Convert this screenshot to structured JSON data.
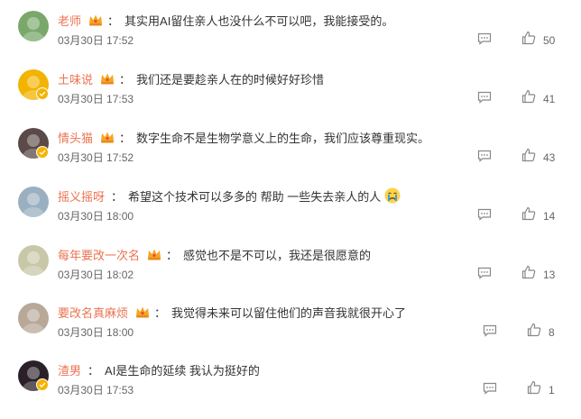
{
  "comments": [
    {
      "user": "老师",
      "text": "其实用AI留住亲人也没什么不可以吧，我能接受的。",
      "date": "03月30日 17:52",
      "likes": "50",
      "has_crown": true,
      "verified": false,
      "emoji": "",
      "avatar_color": "#7aa86b"
    },
    {
      "user": "土味说",
      "text": "我们还是要趁亲人在的时候好好珍惜",
      "date": "03月30日 17:53",
      "likes": "41",
      "has_crown": true,
      "verified": true,
      "emoji": "",
      "avatar_color": "#f2b400"
    },
    {
      "user": "情头猫",
      "text": "数字生命不是生物学意义上的生命，我们应该尊重现实。",
      "date": "03月30日 17:52",
      "likes": "43",
      "has_crown": true,
      "verified": true,
      "emoji": "",
      "avatar_color": "#5a4a48"
    },
    {
      "user": "摇义摇呀",
      "text": "希望这个技术可以多多的 帮助 一些失去亲人的人",
      "date": "03月30日 18:00",
      "likes": "14",
      "has_crown": false,
      "verified": false,
      "emoji": "crying-emoji",
      "avatar_color": "#9ab0c0"
    },
    {
      "user": "每年要改一次名",
      "text": "感觉也不是不可以，我还是很愿意的",
      "date": "03月30日 18:02",
      "likes": "13",
      "has_crown": true,
      "verified": false,
      "emoji": "",
      "avatar_color": "#c8c8a8"
    },
    {
      "user": "要改名真麻烦",
      "text": "我觉得未来可以留住他们的声音我就很开心了",
      "date": "03月30日 18:00",
      "likes": "8",
      "has_crown": true,
      "verified": false,
      "emoji": "",
      "avatar_color": "#b8a898"
    },
    {
      "user": "渣男",
      "text": "AI是生命的延续 我认为挺好的",
      "date": "03月30日 17:53",
      "likes": "1",
      "has_crown": false,
      "verified": true,
      "emoji": "",
      "avatar_color": "#2a2028"
    }
  ],
  "colors": {
    "username": "#eb7350",
    "badge": "#f5b400"
  },
  "icons": {
    "reply": "comment-icon",
    "like": "thumbs-up-icon",
    "crown": "crown-icon",
    "verified": "verified-badge-icon"
  }
}
